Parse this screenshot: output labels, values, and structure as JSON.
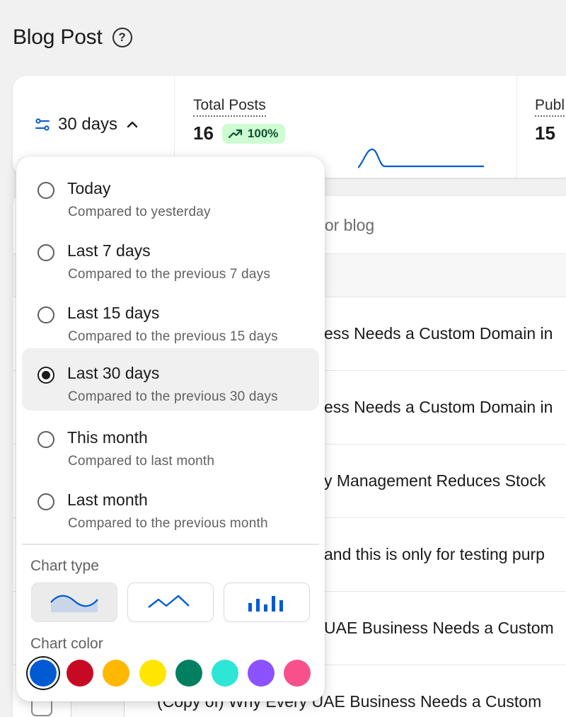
{
  "page": {
    "title": "Blog Post",
    "help_icon": "?"
  },
  "stats": {
    "period": "30 days",
    "total_posts": {
      "label": "Total Posts",
      "value": "16",
      "change": "100%"
    },
    "published": {
      "label": "Publ",
      "value": "15"
    }
  },
  "table": {
    "search_placeholder_visible": "or or blog",
    "rows": [
      "ess Needs a Custom Domain in",
      "ess Needs a Custom Domain in",
      "y Management Reduces Stock",
      "and this is only for testing purp",
      "UAE Business Needs a Custom",
      "(Copy of) Why Every UAE Business Needs a Custom"
    ]
  },
  "dropdown": {
    "options": [
      {
        "label": "Today",
        "sub": "Compared to yesterday",
        "selected": false
      },
      {
        "label": "Last 7 days",
        "sub": "Compared to the previous 7 days",
        "selected": false
      },
      {
        "label": "Last 15 days",
        "sub": "Compared to the previous 15 days",
        "selected": false
      },
      {
        "label": "Last 30 days",
        "sub": "Compared to the previous 30 days",
        "selected": true
      },
      {
        "label": "This month",
        "sub": "Compared to last month",
        "selected": false
      },
      {
        "label": "Last month",
        "sub": "Compared to the previous month",
        "selected": false
      }
    ],
    "chart_type_label": "Chart type",
    "chart_types": [
      "smooth-line",
      "line",
      "bar"
    ],
    "chart_type_selected": "smooth-line",
    "chart_color_label": "Chart color",
    "colors": [
      "#005bd3",
      "#c70a24",
      "#ffb800",
      "#ffe600",
      "#008060",
      "#2ee6d6",
      "#8c52ff",
      "#f7508b"
    ],
    "color_selected": "#005bd3"
  }
}
